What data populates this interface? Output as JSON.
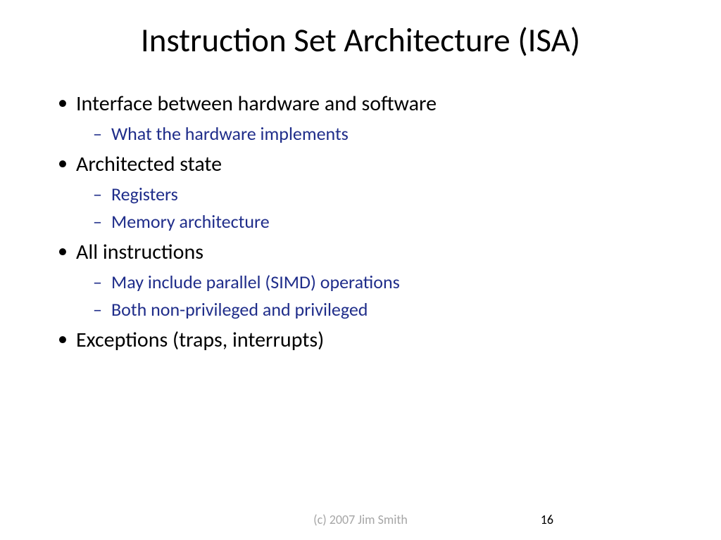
{
  "title": "Instruction Set Architecture (ISA)",
  "bullets": [
    {
      "text": "Interface between hardware and software",
      "sub": [
        "What the hardware implements"
      ]
    },
    {
      "text": "Architected state",
      "sub": [
        "Registers",
        "Memory architecture"
      ]
    },
    {
      "text": "All instructions",
      "sub": [
        "May include parallel (SIMD) operations",
        "Both non-privileged and privileged"
      ]
    },
    {
      "text": "Exceptions (traps, interrupts)",
      "sub": []
    }
  ],
  "footer": {
    "copyright": "(c) 2007 Jim Smith",
    "page_number": "16"
  }
}
